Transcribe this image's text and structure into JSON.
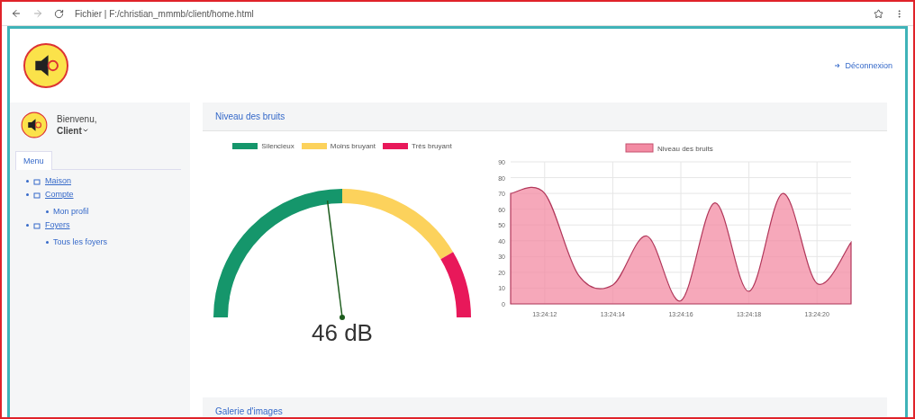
{
  "browser": {
    "url": "Fichier | F:/christian_mmmb/client/home.html"
  },
  "header": {
    "logout": "Déconnexion"
  },
  "sidebar": {
    "greeting": "Bienvenu,",
    "user": "Client",
    "tab": {
      "label": "Menu",
      "selected": true
    },
    "items": [
      {
        "label": "Maison"
      },
      {
        "label": "Compte",
        "children": [
          {
            "label": "Mon profil"
          }
        ]
      },
      {
        "label": "Foyers",
        "children": [
          {
            "label": "Tous les foyers"
          }
        ]
      }
    ]
  },
  "noise_card": {
    "title": "Niveau des bruits",
    "gauge": {
      "legend": [
        {
          "label": "Silencieux",
          "color": "#15966b"
        },
        {
          "label": "Moins bruyant",
          "color": "#fcd25c"
        },
        {
          "label": "Très bruyant",
          "color": "#e8185a"
        }
      ],
      "reading": "46 dB"
    },
    "chart_data": {
      "type": "area",
      "series": [
        {
          "name": "Niveau des bruits",
          "color": "#f38ba3",
          "values": [
            70,
            70,
            18,
            12,
            43,
            2,
            64,
            8,
            70,
            13,
            39
          ]
        }
      ],
      "categories": [
        null,
        "13:24:12",
        null,
        "13:24:14",
        null,
        "13:24:16",
        null,
        "13:24:18",
        null,
        "13:24:20",
        null
      ],
      "grid": true,
      "ylim": [
        0,
        90
      ],
      "yticks": [
        0,
        10,
        20,
        30,
        40,
        50,
        60,
        70,
        80,
        90
      ]
    }
  },
  "gallery_card": {
    "title": "Galerie d'images"
  }
}
